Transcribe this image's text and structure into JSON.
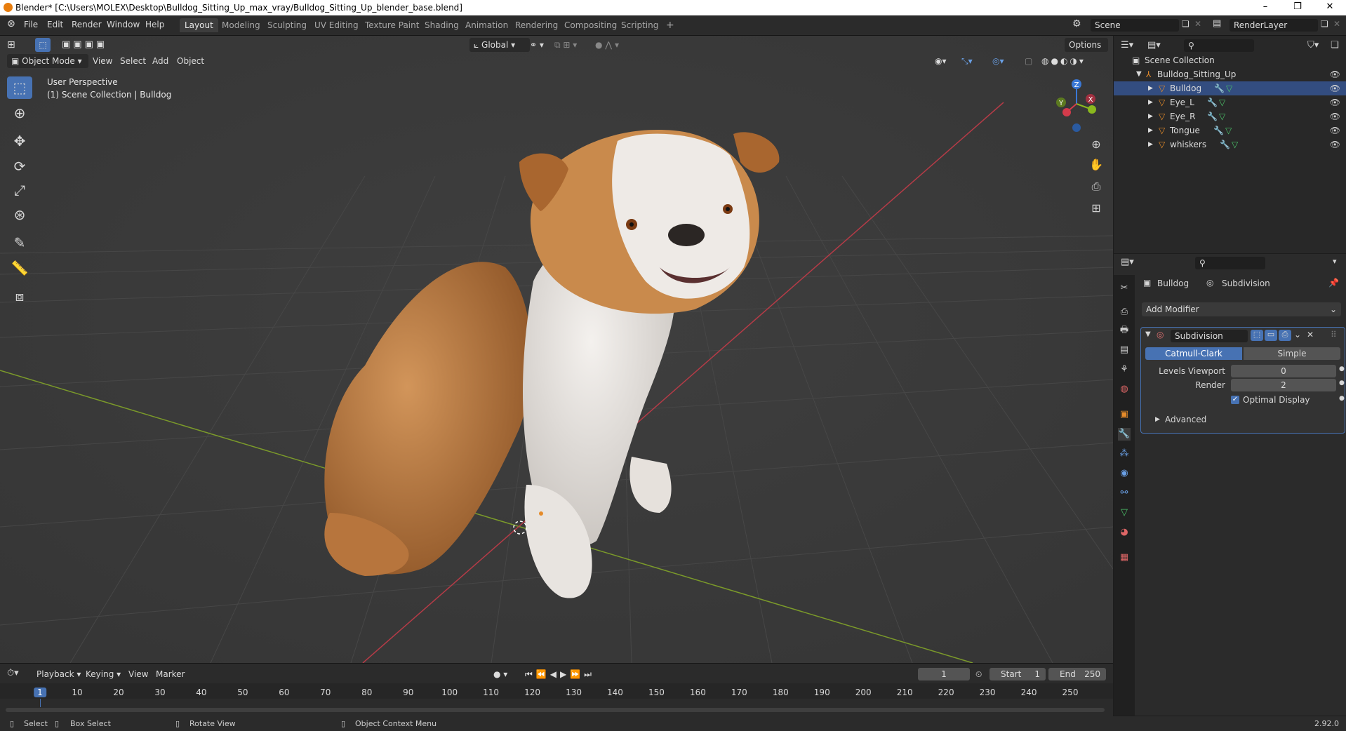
{
  "window": {
    "title": "Blender* [C:\\Users\\MOLEX\\Desktop\\Bulldog_Sitting_Up_max_vray/Bulldog_Sitting_Up_blender_base.blend]",
    "minimize": "–",
    "restore": "❐",
    "close": "✕"
  },
  "menu": {
    "file": "File",
    "edit": "Edit",
    "render": "Render",
    "window": "Window",
    "help": "Help"
  },
  "workspaces": [
    "Layout",
    "Modeling",
    "Sculpting",
    "UV Editing",
    "Texture Paint",
    "Shading",
    "Animation",
    "Rendering",
    "Compositing",
    "Scripting",
    "+"
  ],
  "scene": {
    "scene_name": "Scene",
    "view_layer": "RenderLayer"
  },
  "viewport": {
    "orientation": "Global",
    "options": "Options",
    "mode": "Object Mode",
    "view": "View",
    "select": "Select",
    "add": "Add",
    "object": "Object",
    "perspective": "User Perspective",
    "collection_info": "(1) Scene Collection | Bulldog",
    "gizmo": {
      "x": "X",
      "y": "Y",
      "z": "Z"
    }
  },
  "outliner": {
    "root": "Scene Collection",
    "collection": "Bulldog_Sitting_Up",
    "objects": [
      "Bulldog",
      "Eye_L",
      "Eye_R",
      "Tongue",
      "whiskers"
    ]
  },
  "properties": {
    "object": "Bulldog",
    "modifier_context": "Subdivision",
    "add_modifier": "Add Modifier",
    "modifier_name": "Subdivision",
    "type_catmull": "Catmull-Clark",
    "type_simple": "Simple",
    "levels_viewport_label": "Levels Viewport",
    "levels_viewport_value": "0",
    "render_label": "Render",
    "render_value": "2",
    "optimal_display": "Optimal Display",
    "advanced": "Advanced"
  },
  "timeline": {
    "playback": "Playback",
    "keying": "Keying",
    "view": "View",
    "marker": "Marker",
    "current_frame": "1",
    "start_label": "Start",
    "start_value": "1",
    "end_label": "End",
    "end_value": "250",
    "ruler": [
      "1",
      "10",
      "20",
      "30",
      "40",
      "50",
      "60",
      "70",
      "80",
      "90",
      "100",
      "110",
      "120",
      "130",
      "140",
      "150",
      "160",
      "170",
      "180",
      "190",
      "200",
      "210",
      "220",
      "230",
      "240",
      "250"
    ]
  },
  "statusbar": {
    "select": "Select",
    "box_select": "Box Select",
    "rotate_view": "Rotate View",
    "context_menu": "Object Context Menu",
    "version": "2.92.0"
  },
  "colors": {
    "accent": "#4772b3",
    "x_axis": "#d43b4b",
    "y_axis": "#8ab81e",
    "z_axis": "#3a78d6",
    "object_orange": "#e58b2a"
  }
}
